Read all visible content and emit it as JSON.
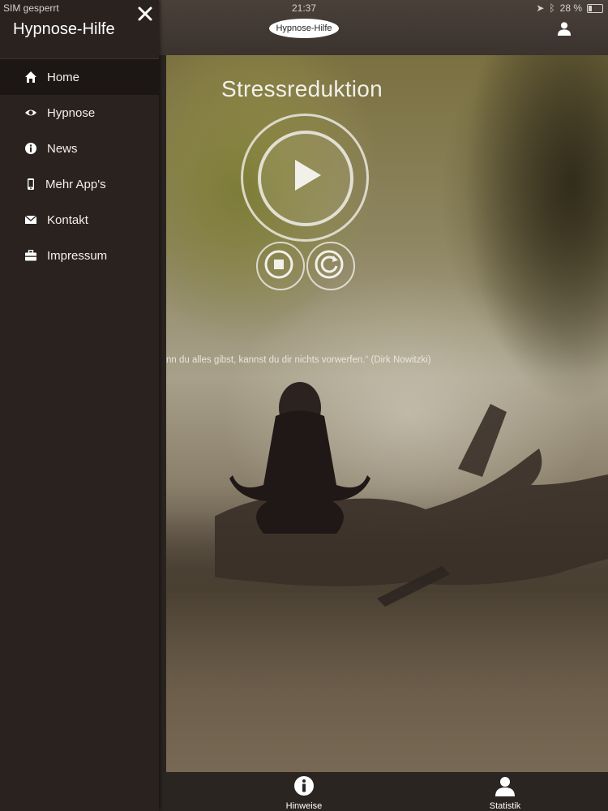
{
  "status_bar": {
    "carrier": "SIM gesperrt",
    "time": "21:37",
    "battery": "28 %",
    "battery_level": 0.28
  },
  "header": {
    "logo_text": "Hypnose-Hilfe",
    "user_icon": "user-icon"
  },
  "sidebar": {
    "title": "Hypnose-Hilfe",
    "close_icon": "close-icon",
    "items": [
      {
        "label": "Home",
        "icon": "home-icon",
        "active": true
      },
      {
        "label": "Hypnose",
        "icon": "eye-icon"
      },
      {
        "label": "News",
        "icon": "info-icon"
      },
      {
        "label": "Mehr App's",
        "icon": "phone-icon"
      },
      {
        "label": "Kontakt",
        "icon": "envelope-icon"
      },
      {
        "label": "Impressum",
        "icon": "briefcase-icon"
      }
    ]
  },
  "player": {
    "title": "Stressreduktion",
    "play_icon": "play-icon",
    "stop_icon": "stop-icon",
    "reload_icon": "reload-icon"
  },
  "quote": "nn du alles gibst, kannst du dir nichts vorwerfen.“ (Dirk Nowitzki)",
  "tabbar": {
    "tabs": [
      {
        "label": "Hinweise",
        "icon": "info-icon"
      },
      {
        "label": "Statistik",
        "icon": "user-icon"
      }
    ]
  }
}
